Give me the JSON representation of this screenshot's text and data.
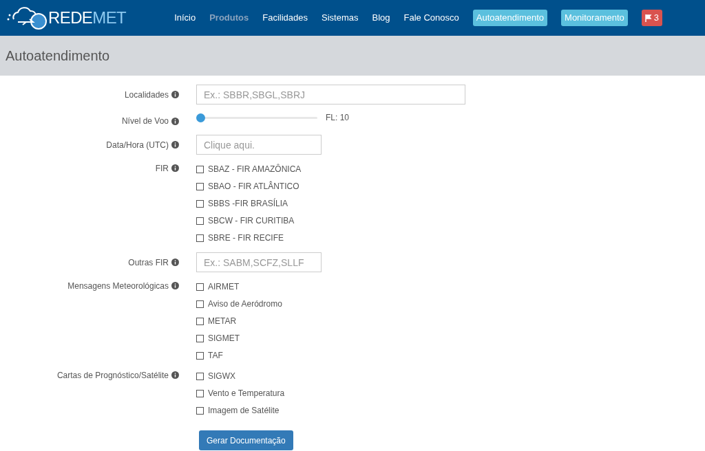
{
  "navbar": {
    "logo_text": [
      "REDE",
      "MET"
    ],
    "items": [
      {
        "label": "Início",
        "kind": "link",
        "selected": false
      },
      {
        "label": "Produtos",
        "kind": "link",
        "selected": true
      },
      {
        "label": "Facilidades",
        "kind": "link",
        "selected": false
      },
      {
        "label": "Sistemas",
        "kind": "link",
        "selected": false
      },
      {
        "label": "Blog",
        "kind": "link",
        "selected": false
      },
      {
        "label": "Fale Conosco",
        "kind": "link",
        "selected": false
      },
      {
        "label": "Autoatendimento",
        "kind": "pill",
        "selected": false
      },
      {
        "label": "Monitoramento",
        "kind": "pill",
        "selected": false
      },
      {
        "label": "3",
        "kind": "alert",
        "selected": false
      }
    ]
  },
  "page_title": "Autoatendimento",
  "form": {
    "rows": [
      {
        "label": "Localidades",
        "kind": "text",
        "placeholder": "Ex.: SBBR,SBGL,SBRJ",
        "wide": true
      },
      {
        "label": "Nível de Voo",
        "kind": "slider",
        "level": 0,
        "reading": "FL: 10"
      },
      {
        "label": "Data/Hora (UTC)",
        "kind": "text",
        "placeholder": "Clique aqui.",
        "wide": false
      },
      {
        "label": "FIR",
        "kind": "checkboxes",
        "options": [
          {
            "label": "SBAZ - FIR AMAZÔNICA",
            "checked": false
          },
          {
            "label": "SBAO - FIR ATLÂNTICO",
            "checked": false
          },
          {
            "label": "SBBS -FIR BRASÍLIA",
            "checked": false
          },
          {
            "label": "SBCW - FIR CURITIBA",
            "checked": false
          },
          {
            "label": "SBRE - FIR RECIFE",
            "checked": false
          }
        ]
      },
      {
        "label": "Outras FIR",
        "kind": "text",
        "placeholder": "Ex.: SABM,SCFZ,SLLF",
        "wide": false
      },
      {
        "label": "Mensagens Meteorológicas",
        "kind": "checkboxes",
        "options": [
          {
            "label": "AIRMET",
            "checked": false
          },
          {
            "label": "Aviso de Aeródromo",
            "checked": false
          },
          {
            "label": "METAR",
            "checked": false
          },
          {
            "label": "SIGMET",
            "checked": false
          },
          {
            "label": "TAF",
            "checked": false
          }
        ]
      },
      {
        "label": "Cartas de Prognóstico/Satélite",
        "kind": "checkboxes",
        "options": [
          {
            "label": "SIGWX",
            "checked": false
          },
          {
            "label": "Vento e Temperatura",
            "checked": false
          },
          {
            "label": "Imagem de Satélite",
            "checked": false
          }
        ]
      }
    ],
    "submit": "Gerar Documentação"
  }
}
